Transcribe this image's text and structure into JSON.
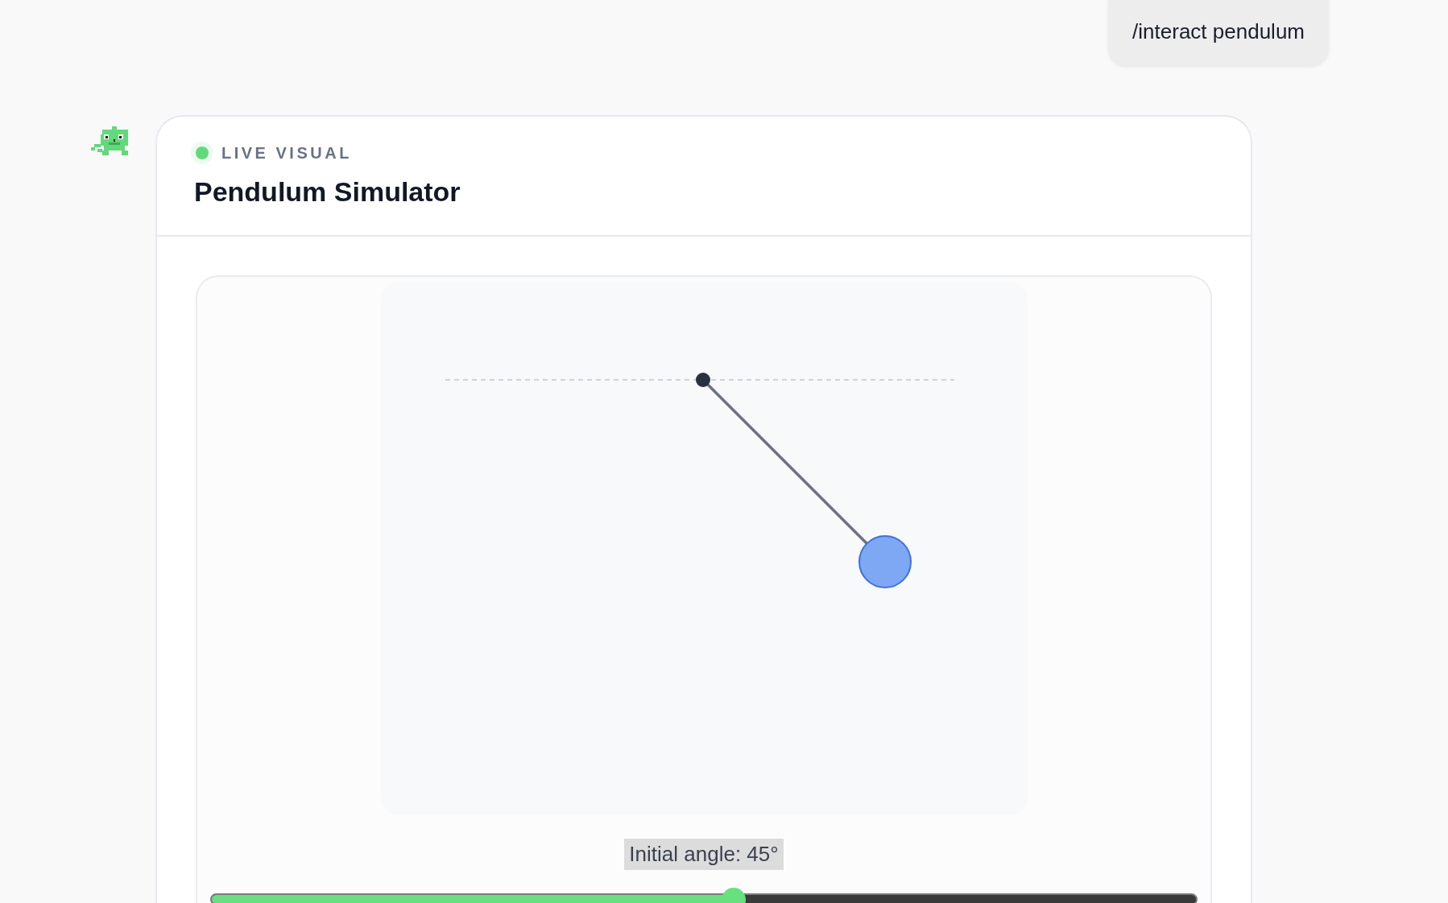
{
  "user_message": {
    "text": "/interact pendulum"
  },
  "visual_card": {
    "status_label": "LIVE VISUAL",
    "live": true,
    "title": "Pendulum Simulator",
    "control": {
      "label": "Initial angle: 45°",
      "label_selected": true,
      "level": 0.53
    }
  }
}
